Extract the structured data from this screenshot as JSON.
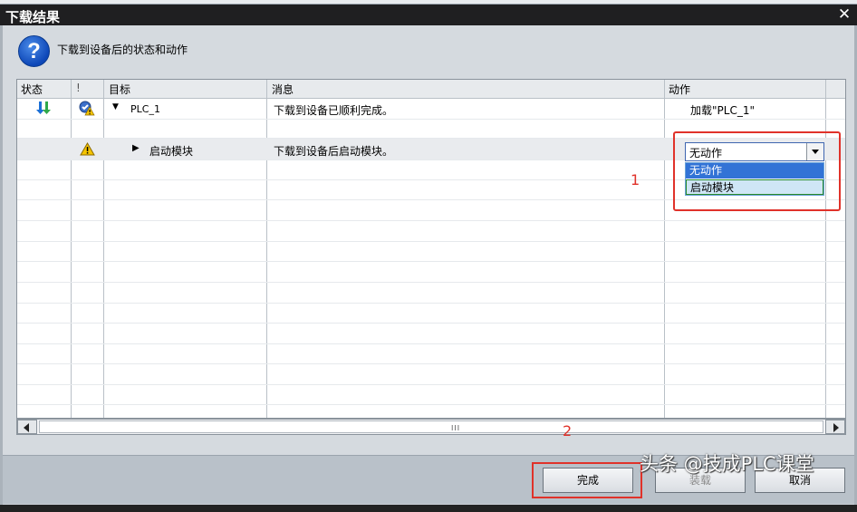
{
  "window": {
    "title": "下载结果",
    "close_icon": "close-icon"
  },
  "header": {
    "icon": "question-icon",
    "text": "下载到设备后的状态和动作"
  },
  "grid": {
    "columns": [
      "状态",
      "!",
      "目标",
      "消息",
      "动作"
    ],
    "rows": [
      {
        "status_icon": "download-arrows-icon",
        "warn_icon": "check-warning-icon",
        "expander": "expanded",
        "target": "PLC_1",
        "message": "下载到设备已顺利完成。",
        "action": "加载\"PLC_1\""
      },
      {
        "warn_icon": "warning-icon",
        "expander": "collapsed",
        "target": "启动模块",
        "message": "下载到设备后启动模块。",
        "action": "无动作"
      }
    ]
  },
  "dropdown": {
    "selected": "无动作",
    "options": [
      "无动作",
      "启动模块"
    ]
  },
  "annotations": {
    "label1": "1",
    "label2": "2",
    "color": "#e0322a"
  },
  "scrollbar": {
    "grip": "III"
  },
  "buttons": {
    "finish": "完成",
    "load": "装载",
    "cancel": "取消"
  },
  "watermark": "头条 @技成PLC课堂"
}
